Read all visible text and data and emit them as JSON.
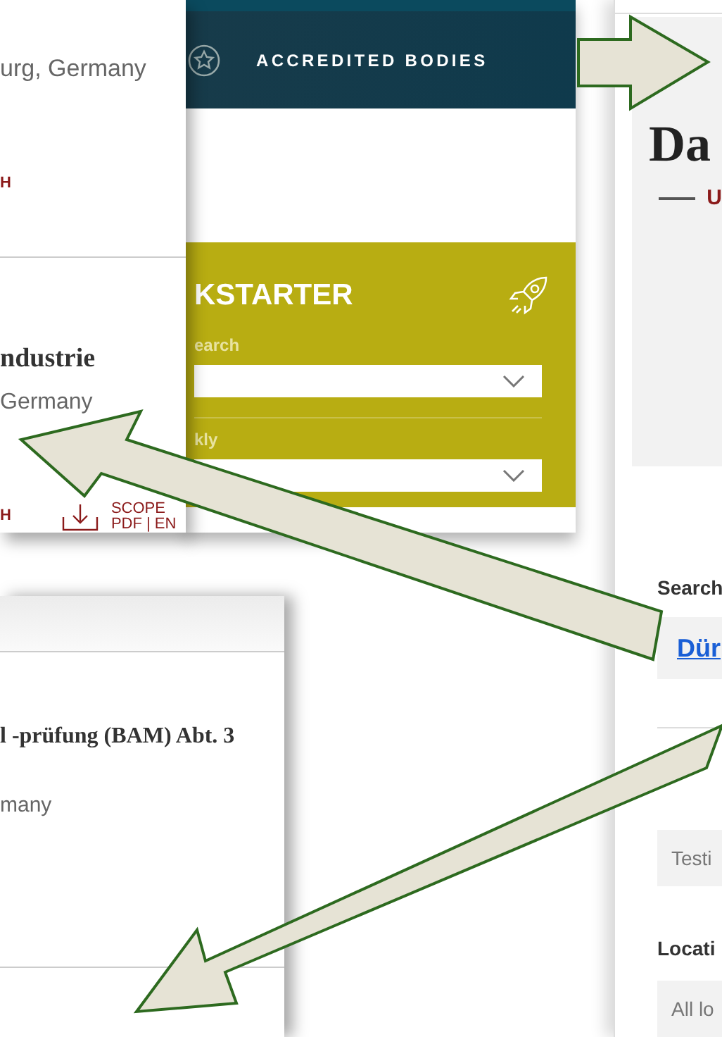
{
  "top_card": {
    "entries": [
      {
        "location": "urg, Germany",
        "link": "H"
      },
      {
        "title": "ndustrie",
        "location": "Germany",
        "link": "H",
        "scope": {
          "line_1": "SCOPE",
          "line_2": "PDF | EN"
        }
      }
    ]
  },
  "middle_panel": {
    "nav_label": "ACCREDITED BODIES",
    "kickstarter": {
      "title": "KSTARTER",
      "fields": [
        {
          "label": "earch"
        },
        {
          "label": "kly"
        }
      ]
    }
  },
  "right_panel": {
    "heading": "Da",
    "subheading": "U",
    "search_label": "Search",
    "search_link": "Dür",
    "type_field": {
      "value": "Testi"
    },
    "location_label": "Locati",
    "location_field": {
      "value": "All lo"
    }
  },
  "bottom_card": {
    "title": "l -prüfung (BAM) Abt. 3",
    "location": "many"
  }
}
